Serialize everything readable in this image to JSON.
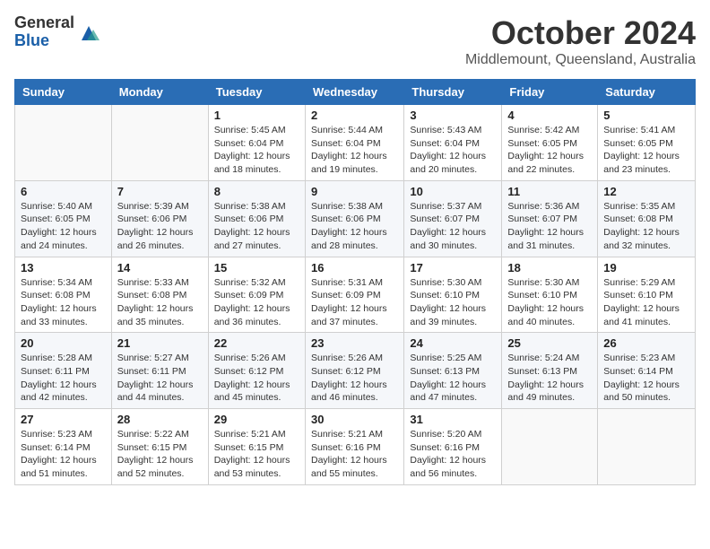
{
  "header": {
    "logo_general": "General",
    "logo_blue": "Blue",
    "month_title": "October 2024",
    "location": "Middlemount, Queensland, Australia"
  },
  "weekdays": [
    "Sunday",
    "Monday",
    "Tuesday",
    "Wednesday",
    "Thursday",
    "Friday",
    "Saturday"
  ],
  "weeks": [
    [
      {
        "day": "",
        "info": ""
      },
      {
        "day": "",
        "info": ""
      },
      {
        "day": "1",
        "info": "Sunrise: 5:45 AM\nSunset: 6:04 PM\nDaylight: 12 hours and 18 minutes."
      },
      {
        "day": "2",
        "info": "Sunrise: 5:44 AM\nSunset: 6:04 PM\nDaylight: 12 hours and 19 minutes."
      },
      {
        "day": "3",
        "info": "Sunrise: 5:43 AM\nSunset: 6:04 PM\nDaylight: 12 hours and 20 minutes."
      },
      {
        "day": "4",
        "info": "Sunrise: 5:42 AM\nSunset: 6:05 PM\nDaylight: 12 hours and 22 minutes."
      },
      {
        "day": "5",
        "info": "Sunrise: 5:41 AM\nSunset: 6:05 PM\nDaylight: 12 hours and 23 minutes."
      }
    ],
    [
      {
        "day": "6",
        "info": "Sunrise: 5:40 AM\nSunset: 6:05 PM\nDaylight: 12 hours and 24 minutes."
      },
      {
        "day": "7",
        "info": "Sunrise: 5:39 AM\nSunset: 6:06 PM\nDaylight: 12 hours and 26 minutes."
      },
      {
        "day": "8",
        "info": "Sunrise: 5:38 AM\nSunset: 6:06 PM\nDaylight: 12 hours and 27 minutes."
      },
      {
        "day": "9",
        "info": "Sunrise: 5:38 AM\nSunset: 6:06 PM\nDaylight: 12 hours and 28 minutes."
      },
      {
        "day": "10",
        "info": "Sunrise: 5:37 AM\nSunset: 6:07 PM\nDaylight: 12 hours and 30 minutes."
      },
      {
        "day": "11",
        "info": "Sunrise: 5:36 AM\nSunset: 6:07 PM\nDaylight: 12 hours and 31 minutes."
      },
      {
        "day": "12",
        "info": "Sunrise: 5:35 AM\nSunset: 6:08 PM\nDaylight: 12 hours and 32 minutes."
      }
    ],
    [
      {
        "day": "13",
        "info": "Sunrise: 5:34 AM\nSunset: 6:08 PM\nDaylight: 12 hours and 33 minutes."
      },
      {
        "day": "14",
        "info": "Sunrise: 5:33 AM\nSunset: 6:08 PM\nDaylight: 12 hours and 35 minutes."
      },
      {
        "day": "15",
        "info": "Sunrise: 5:32 AM\nSunset: 6:09 PM\nDaylight: 12 hours and 36 minutes."
      },
      {
        "day": "16",
        "info": "Sunrise: 5:31 AM\nSunset: 6:09 PM\nDaylight: 12 hours and 37 minutes."
      },
      {
        "day": "17",
        "info": "Sunrise: 5:30 AM\nSunset: 6:10 PM\nDaylight: 12 hours and 39 minutes."
      },
      {
        "day": "18",
        "info": "Sunrise: 5:30 AM\nSunset: 6:10 PM\nDaylight: 12 hours and 40 minutes."
      },
      {
        "day": "19",
        "info": "Sunrise: 5:29 AM\nSunset: 6:10 PM\nDaylight: 12 hours and 41 minutes."
      }
    ],
    [
      {
        "day": "20",
        "info": "Sunrise: 5:28 AM\nSunset: 6:11 PM\nDaylight: 12 hours and 42 minutes."
      },
      {
        "day": "21",
        "info": "Sunrise: 5:27 AM\nSunset: 6:11 PM\nDaylight: 12 hours and 44 minutes."
      },
      {
        "day": "22",
        "info": "Sunrise: 5:26 AM\nSunset: 6:12 PM\nDaylight: 12 hours and 45 minutes."
      },
      {
        "day": "23",
        "info": "Sunrise: 5:26 AM\nSunset: 6:12 PM\nDaylight: 12 hours and 46 minutes."
      },
      {
        "day": "24",
        "info": "Sunrise: 5:25 AM\nSunset: 6:13 PM\nDaylight: 12 hours and 47 minutes."
      },
      {
        "day": "25",
        "info": "Sunrise: 5:24 AM\nSunset: 6:13 PM\nDaylight: 12 hours and 49 minutes."
      },
      {
        "day": "26",
        "info": "Sunrise: 5:23 AM\nSunset: 6:14 PM\nDaylight: 12 hours and 50 minutes."
      }
    ],
    [
      {
        "day": "27",
        "info": "Sunrise: 5:23 AM\nSunset: 6:14 PM\nDaylight: 12 hours and 51 minutes."
      },
      {
        "day": "28",
        "info": "Sunrise: 5:22 AM\nSunset: 6:15 PM\nDaylight: 12 hours and 52 minutes."
      },
      {
        "day": "29",
        "info": "Sunrise: 5:21 AM\nSunset: 6:15 PM\nDaylight: 12 hours and 53 minutes."
      },
      {
        "day": "30",
        "info": "Sunrise: 5:21 AM\nSunset: 6:16 PM\nDaylight: 12 hours and 55 minutes."
      },
      {
        "day": "31",
        "info": "Sunrise: 5:20 AM\nSunset: 6:16 PM\nDaylight: 12 hours and 56 minutes."
      },
      {
        "day": "",
        "info": ""
      },
      {
        "day": "",
        "info": ""
      }
    ]
  ]
}
